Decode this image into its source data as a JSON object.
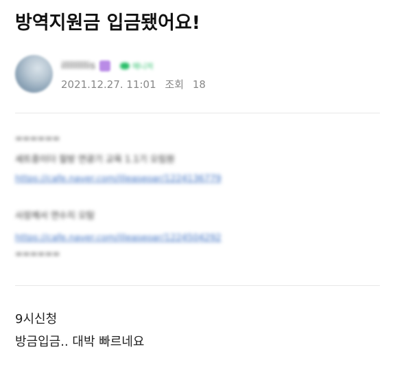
{
  "post": {
    "title": "방역지원금 입금됐어요!",
    "author": {
      "name": "illlllllllis",
      "badge": "매니저",
      "date": "2021.12.27. 11:01",
      "views_label": "조회",
      "views": "18"
    },
    "blurred_block": {
      "line1": "======",
      "line2": "세트중이더 절방 연광기 교육 1.1기 오림원",
      "link1": "https://cafe.naver.com/illeaseoar/1224136779",
      "line3": "사장께서 연수지 오탐",
      "link2": "https://cafe.naver.com/illeaseoar/1224504292",
      "line4": "======"
    },
    "body_lines": [
      "9시신청",
      "방금입금.. 대박 빠르네요"
    ]
  }
}
